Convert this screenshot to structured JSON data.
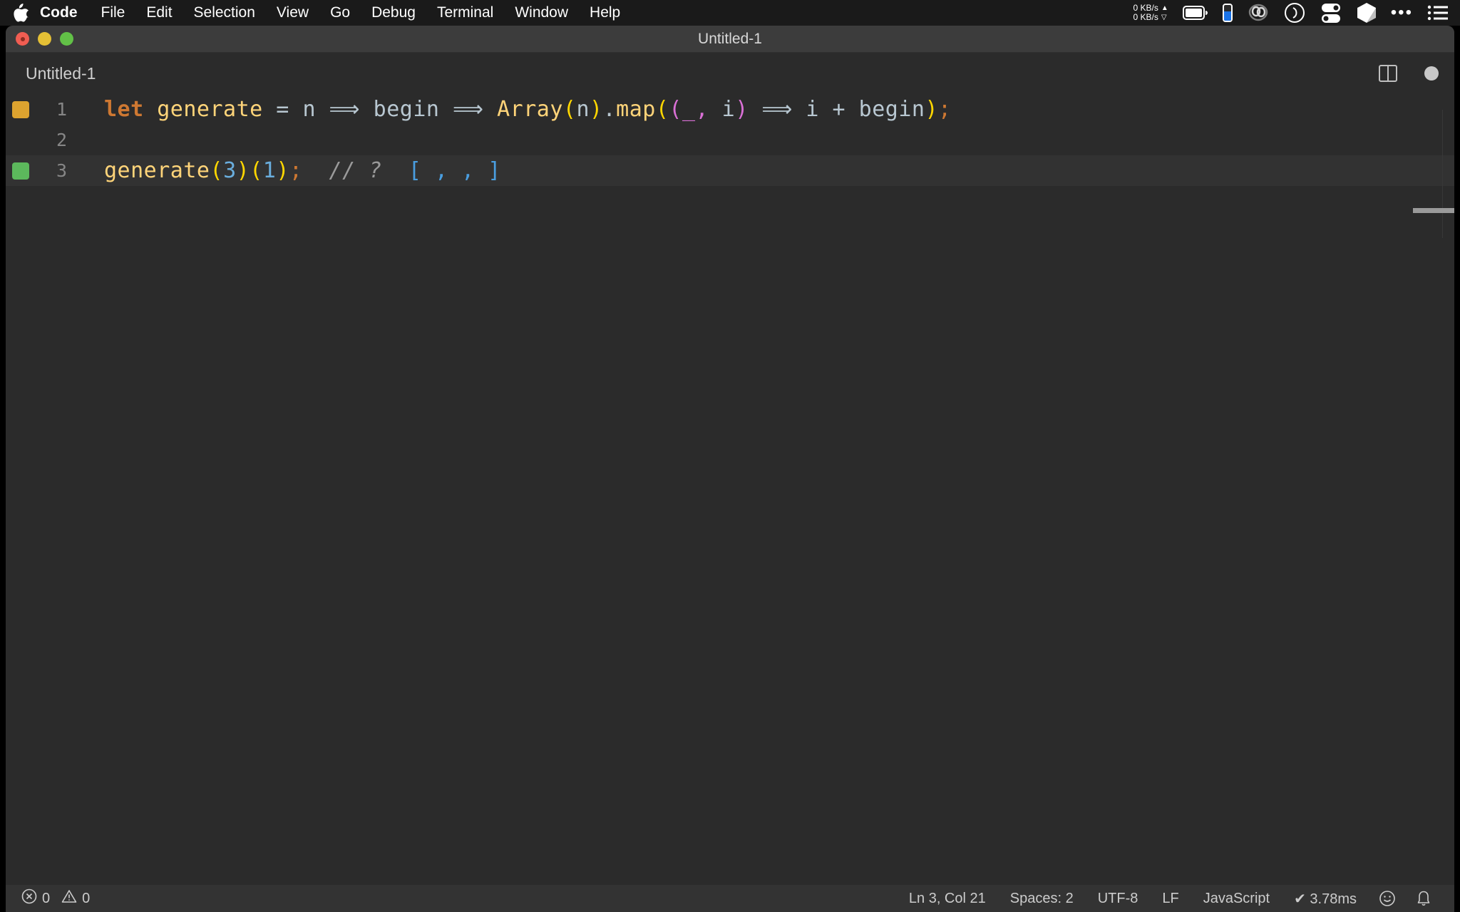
{
  "menubar": {
    "apple_icon": "apple-logo-icon",
    "items": [
      {
        "label": "Code",
        "bold": true
      },
      {
        "label": "File",
        "bold": false
      },
      {
        "label": "Edit",
        "bold": false
      },
      {
        "label": "Selection",
        "bold": false
      },
      {
        "label": "View",
        "bold": false
      },
      {
        "label": "Go",
        "bold": false
      },
      {
        "label": "Debug",
        "bold": false
      },
      {
        "label": "Terminal",
        "bold": false
      },
      {
        "label": "Window",
        "bold": false
      },
      {
        "label": "Help",
        "bold": false
      }
    ],
    "network": {
      "upload": "0 KB/s",
      "download": "0 KB/s",
      "up_arrow": "▲",
      "down_arrow": "▽"
    },
    "status_icons": [
      "battery-icon",
      "battery-level-icon",
      "cloud-eye-icon",
      "clock-icon",
      "toggles-icon",
      "cube-icon",
      "ellipsis-icon",
      "list-menu-icon"
    ]
  },
  "window": {
    "title": "Untitled-1",
    "traffic_lights": [
      "close",
      "minimize",
      "maximize"
    ]
  },
  "tabbar": {
    "active_tab": "Untitled-1",
    "actions": [
      "split-editor-icon",
      "unsaved-indicator-icon"
    ]
  },
  "editor": {
    "language": "JavaScript",
    "lines": [
      {
        "number": "1",
        "glyph": "orange",
        "active": false,
        "tokens": [
          {
            "text": "let",
            "cls": "t-kw"
          },
          {
            "text": " ",
            "cls": "t-plain"
          },
          {
            "text": "generate",
            "cls": "t-fn"
          },
          {
            "text": " = ",
            "cls": "t-op"
          },
          {
            "text": "n",
            "cls": "t-plain"
          },
          {
            "text": " ⟹ ",
            "cls": "t-op"
          },
          {
            "text": "begin",
            "cls": "t-plain"
          },
          {
            "text": " ⟹ ",
            "cls": "t-op"
          },
          {
            "text": "Array",
            "cls": "t-fn"
          },
          {
            "text": "(",
            "cls": "t-par-y"
          },
          {
            "text": "n",
            "cls": "t-plain"
          },
          {
            "text": ")",
            "cls": "t-par-y"
          },
          {
            "text": ".",
            "cls": "t-plain"
          },
          {
            "text": "map",
            "cls": "t-fn"
          },
          {
            "text": "(",
            "cls": "t-par-y"
          },
          {
            "text": "(",
            "cls": "t-par-m"
          },
          {
            "text": "_",
            "cls": "t-par-m"
          },
          {
            "text": ",",
            "cls": "t-par-m"
          },
          {
            "text": " i",
            "cls": "t-plain"
          },
          {
            "text": ")",
            "cls": "t-par-m"
          },
          {
            "text": " ⟹ ",
            "cls": "t-op"
          },
          {
            "text": "i + ",
            "cls": "t-plain"
          },
          {
            "text": "begin",
            "cls": "t-plain"
          },
          {
            "text": ")",
            "cls": "t-par-y"
          },
          {
            "text": ";",
            "cls": "t-semi"
          }
        ]
      },
      {
        "number": "2",
        "glyph": "none",
        "active": false,
        "tokens": []
      },
      {
        "number": "3",
        "glyph": "green",
        "active": true,
        "tokens": [
          {
            "text": "generate",
            "cls": "t-fn"
          },
          {
            "text": "(",
            "cls": "t-par-y"
          },
          {
            "text": "3",
            "cls": "t-num"
          },
          {
            "text": ")",
            "cls": "t-par-y"
          },
          {
            "text": "(",
            "cls": "t-par-y"
          },
          {
            "text": "1",
            "cls": "t-num"
          },
          {
            "text": ")",
            "cls": "t-par-y"
          },
          {
            "text": ";",
            "cls": "t-semi"
          },
          {
            "text": "  // ?",
            "cls": "t-comment"
          },
          {
            "text": "  [ , , ]",
            "cls": "t-result"
          }
        ]
      }
    ]
  },
  "statusbar": {
    "error_icon": "error-circle-icon",
    "error_count": "0",
    "warning_icon": "warning-triangle-icon",
    "warning_count": "0",
    "cursor_position": "Ln 3, Col 21",
    "indentation": "Spaces: 2",
    "encoding": "UTF-8",
    "eol": "LF",
    "language_mode": "JavaScript",
    "run_time": "✔ 3.78ms",
    "feedback_icon": "smiley-icon",
    "notifications_icon": "bell-icon"
  },
  "colors": {
    "menubar_bg": "#1a1a1a",
    "titlebar_bg": "#3c3c3c",
    "editor_bg": "#2b2b2b",
    "statusbar_bg": "#333333",
    "keyword": "#ce7832",
    "function": "#ffd479",
    "number": "#6aaede",
    "result_hint": "#4a9ee0",
    "glyph_orange": "#dda32f",
    "glyph_green": "#5cb85c"
  }
}
